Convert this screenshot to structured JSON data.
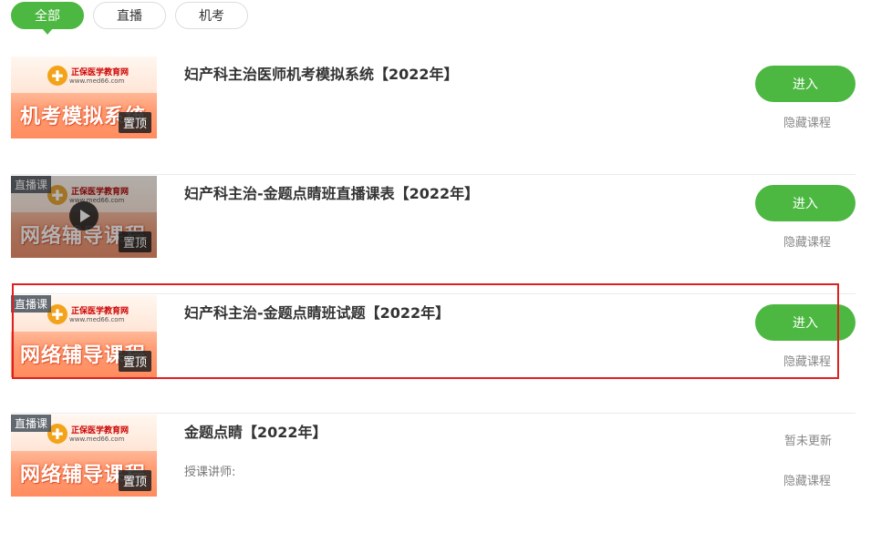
{
  "tabs": [
    {
      "label": "全部",
      "active": true
    },
    {
      "label": "直播",
      "active": false
    },
    {
      "label": "机考",
      "active": false
    }
  ],
  "thumb_common": {
    "brand": "正保医学教育网",
    "url": "www.med66.com",
    "top_badge": "置顶",
    "live_badge": "直播课"
  },
  "courses": [
    {
      "title": "妇产科主治医师机考模拟系统【2022年】",
      "slogan": "机考模拟系统",
      "enter": "进入",
      "hide": "隐藏课程"
    },
    {
      "title": "妇产科主治-金题点睛班直播课表【2022年】",
      "slogan": "网络辅导课程",
      "enter": "进入",
      "hide": "隐藏课程"
    },
    {
      "title": "妇产科主治-金题点睛班试题【2022年】",
      "slogan": "网络辅导课程",
      "enter": "进入",
      "hide": "隐藏课程"
    },
    {
      "title": "金题点睛【2022年】",
      "slogan": "网络辅导课程",
      "teacher": "授课讲师:",
      "status": "暂未更新",
      "hide": "隐藏课程"
    }
  ],
  "colors": {
    "accent": "#4cb842",
    "highlight": "#e02020"
  }
}
